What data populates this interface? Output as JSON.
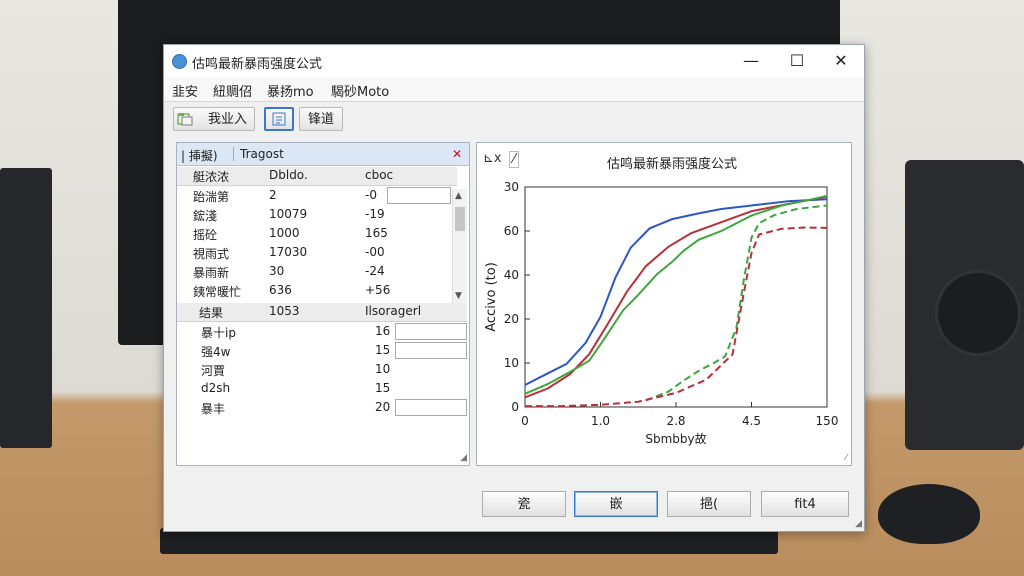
{
  "window": {
    "title": "估鸣最新暴雨强度公式",
    "controls": {
      "minimize": "—",
      "maximize": "☐",
      "close": "✕"
    }
  },
  "menu": [
    "韭安",
    "紐赒佋",
    "暴扬mo",
    "騔砂Moto"
  ],
  "toolbar": {
    "import_label": "我业入",
    "edit_label": "",
    "save_label": "锋道"
  },
  "params_panel": {
    "tab1": "| 挿擬)",
    "tab2": "Tragost",
    "close": "✕",
    "header": {
      "name": "艇浓浓",
      "value": "Dbldo.",
      "extra": "cboc"
    },
    "rows": [
      {
        "name": "跆湍第",
        "value": "2",
        "extra": "-0"
      },
      {
        "name": "鋐淺",
        "value": "10079",
        "extra": "-19"
      },
      {
        "name": "摇砼",
        "value": "1000",
        "extra": "165"
      },
      {
        "name": "視雨式",
        "value": "17030",
        "extra": "-00"
      },
      {
        "name": "暴雨新",
        "value": "30",
        "extra": "-24"
      },
      {
        "name": "銕常暖忙",
        "value": "636",
        "extra": "+56"
      }
    ],
    "header2": {
      "name": "结果",
      "value": "1053",
      "extra": "Ilsoragerl"
    },
    "rows2": [
      {
        "name": "暴十ip",
        "extra": "16"
      },
      {
        "name": "强4w",
        "extra": "15"
      },
      {
        "name": "河賈",
        "extra": "10"
      },
      {
        "name": "d2sh",
        "extra": "15"
      },
      {
        "name": "暴丰",
        "extra": "20"
      }
    ]
  },
  "chart_panel": {
    "tool1": "⊾x",
    "tool2": "⁄",
    "grip": "⁄"
  },
  "chart_data": {
    "type": "line",
    "title": "估鸣最新暴雨强度公式",
    "xlabel": "Sbmbby故",
    "ylabel": "Accivo (to)",
    "x_ticks": [
      "0",
      "1.0",
      "2.8",
      "4.5",
      "150"
    ],
    "y_ticks": [
      "0",
      "10",
      "20",
      "40",
      "60",
      "30"
    ],
    "xlim": [
      0,
      4
    ],
    "ylim": [
      0,
      5
    ],
    "grid": false,
    "series": [
      {
        "color": "#2f56c6",
        "style": "solid",
        "points": [
          [
            0,
            0.5
          ],
          [
            0.25,
            0.72
          ],
          [
            0.55,
            0.98
          ],
          [
            0.8,
            1.45
          ],
          [
            1.0,
            2.05
          ],
          [
            1.2,
            2.95
          ],
          [
            1.4,
            3.62
          ],
          [
            1.65,
            4.06
          ],
          [
            1.95,
            4.27
          ],
          [
            2.3,
            4.4
          ],
          [
            2.6,
            4.5
          ],
          [
            3.0,
            4.58
          ],
          [
            3.5,
            4.68
          ],
          [
            4.0,
            4.72
          ]
        ]
      },
      {
        "color": "#b8303a",
        "style": "solid",
        "points": [
          [
            0,
            0.22
          ],
          [
            0.3,
            0.42
          ],
          [
            0.6,
            0.75
          ],
          [
            0.85,
            1.2
          ],
          [
            1.1,
            1.9
          ],
          [
            1.35,
            2.62
          ],
          [
            1.6,
            3.2
          ],
          [
            1.9,
            3.64
          ],
          [
            2.2,
            3.95
          ],
          [
            2.6,
            4.2
          ],
          [
            3.0,
            4.45
          ],
          [
            3.5,
            4.62
          ],
          [
            4.0,
            4.78
          ]
        ]
      },
      {
        "color": "#3fa63f",
        "style": "solid",
        "points": [
          [
            0,
            0.3
          ],
          [
            0.3,
            0.52
          ],
          [
            0.6,
            0.8
          ],
          [
            0.85,
            1.05
          ],
          [
            1.05,
            1.55
          ],
          [
            1.3,
            2.2
          ],
          [
            1.5,
            2.55
          ],
          [
            1.75,
            3.02
          ],
          [
            1.95,
            3.3
          ],
          [
            2.1,
            3.55
          ],
          [
            2.3,
            3.8
          ],
          [
            2.6,
            4.0
          ],
          [
            3.0,
            4.35
          ],
          [
            3.4,
            4.58
          ],
          [
            3.75,
            4.7
          ],
          [
            4.0,
            4.8
          ]
        ]
      },
      {
        "color": "#3fa63f",
        "style": "dashed",
        "points": [
          [
            1.6,
            0.15
          ],
          [
            1.9,
            0.35
          ],
          [
            2.1,
            0.6
          ],
          [
            2.3,
            0.82
          ],
          [
            2.5,
            1.0
          ],
          [
            2.65,
            1.15
          ],
          [
            2.8,
            1.8
          ],
          [
            2.9,
            2.9
          ],
          [
            3.0,
            3.85
          ],
          [
            3.1,
            4.18
          ],
          [
            3.3,
            4.36
          ],
          [
            3.6,
            4.5
          ],
          [
            4.0,
            4.58
          ]
        ]
      },
      {
        "color": "#b8303a",
        "style": "dashed",
        "points": [
          [
            0,
            0.02
          ],
          [
            0.5,
            0.02
          ],
          [
            1.0,
            0.05
          ],
          [
            1.5,
            0.12
          ],
          [
            2.0,
            0.32
          ],
          [
            2.4,
            0.62
          ],
          [
            2.75,
            1.2
          ],
          [
            2.9,
            2.6
          ],
          [
            3.0,
            3.5
          ],
          [
            3.1,
            3.92
          ],
          [
            3.4,
            4.05
          ],
          [
            3.7,
            4.08
          ],
          [
            4.0,
            4.07
          ]
        ]
      }
    ]
  },
  "buttons": [
    "瓷",
    "嵌",
    "挹(",
    "fit4"
  ]
}
